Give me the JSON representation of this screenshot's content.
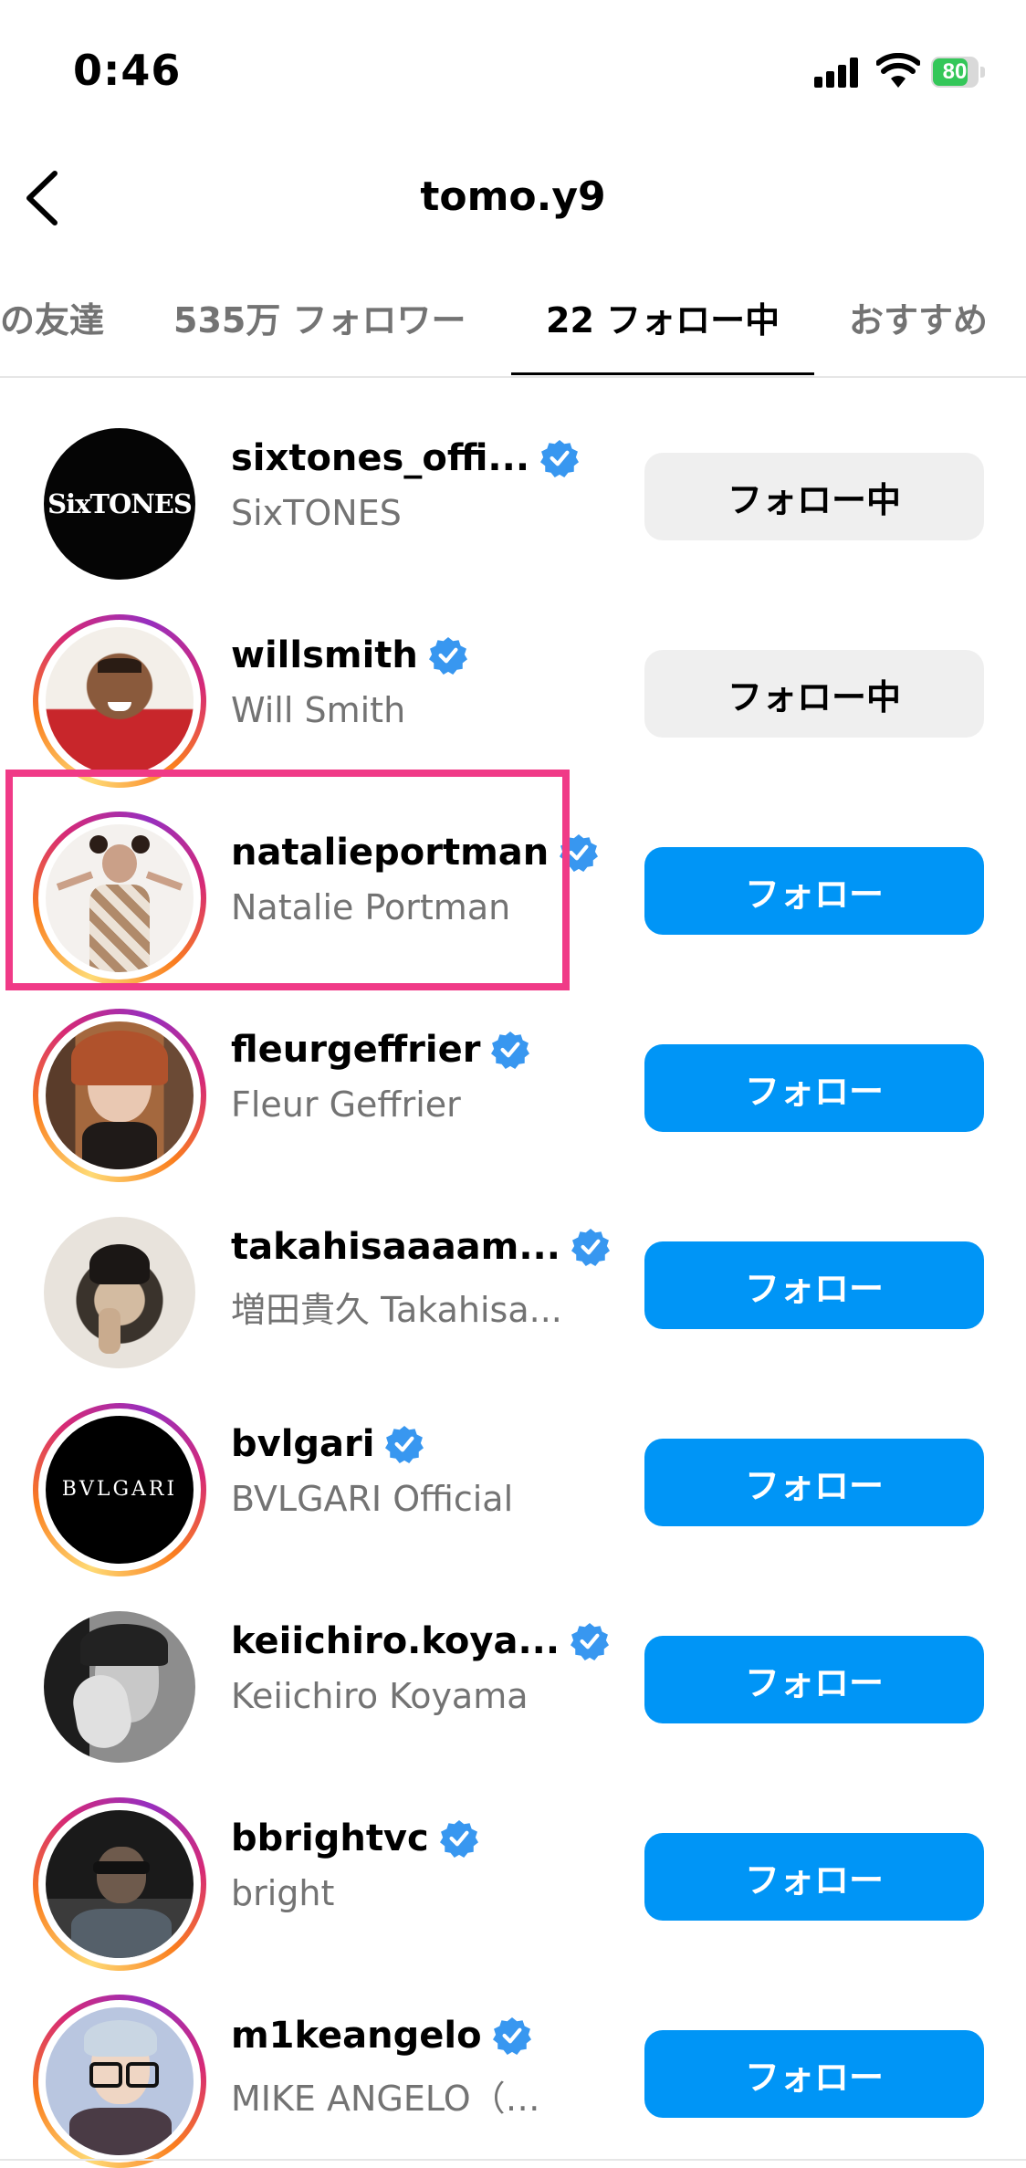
{
  "status_bar": {
    "time": "0:46",
    "battery": "80",
    "battery_level": 0.8
  },
  "header": {
    "title": "tomo.y9"
  },
  "tabs": [
    {
      "label": "の友達"
    },
    {
      "label": "535万 フォロワー"
    },
    {
      "label": "22 フォロー中",
      "active": true
    },
    {
      "label": "おすすめ"
    }
  ],
  "colors": {
    "follow": "#0095f6",
    "following_bg": "#efefef",
    "highlight": "#f03a87",
    "verified": "#3897f0"
  },
  "users": [
    {
      "username": "sixtones_offi...",
      "fullname": "SixTONES",
      "button": "フォロー中",
      "state": "following",
      "avatar_text": "SixTONES",
      "story_ring": false
    },
    {
      "username": "willsmith",
      "fullname": "Will Smith",
      "button": "フォロー中",
      "state": "following",
      "story_ring": true
    },
    {
      "username": "natalieportman",
      "fullname": "Natalie Portman",
      "button": "フォロー",
      "state": "follow",
      "story_ring": true,
      "highlighted": true
    },
    {
      "username": "fleurgeffrier",
      "fullname": "Fleur Geffrier",
      "button": "フォロー",
      "state": "follow",
      "story_ring": true
    },
    {
      "username": "takahisaaaam...",
      "fullname": "増田貴久 Takahisa...",
      "button": "フォロー",
      "state": "follow",
      "story_ring": false
    },
    {
      "username": "bvlgari",
      "fullname": "BVLGARI Official",
      "button": "フォロー",
      "state": "follow",
      "avatar_text": "BVLGARI",
      "story_ring": true
    },
    {
      "username": "keiichiro.koya...",
      "fullname": "Keiichiro Koyama",
      "button": "フォロー",
      "state": "follow",
      "story_ring": false
    },
    {
      "username": "bbrightvc",
      "fullname": "bright",
      "button": "フォロー",
      "state": "follow",
      "story_ring": true
    },
    {
      "username": "m1keangelo",
      "fullname": "MIKE ANGELO（…",
      "button": "フォロー",
      "state": "follow",
      "story_ring": true
    }
  ]
}
